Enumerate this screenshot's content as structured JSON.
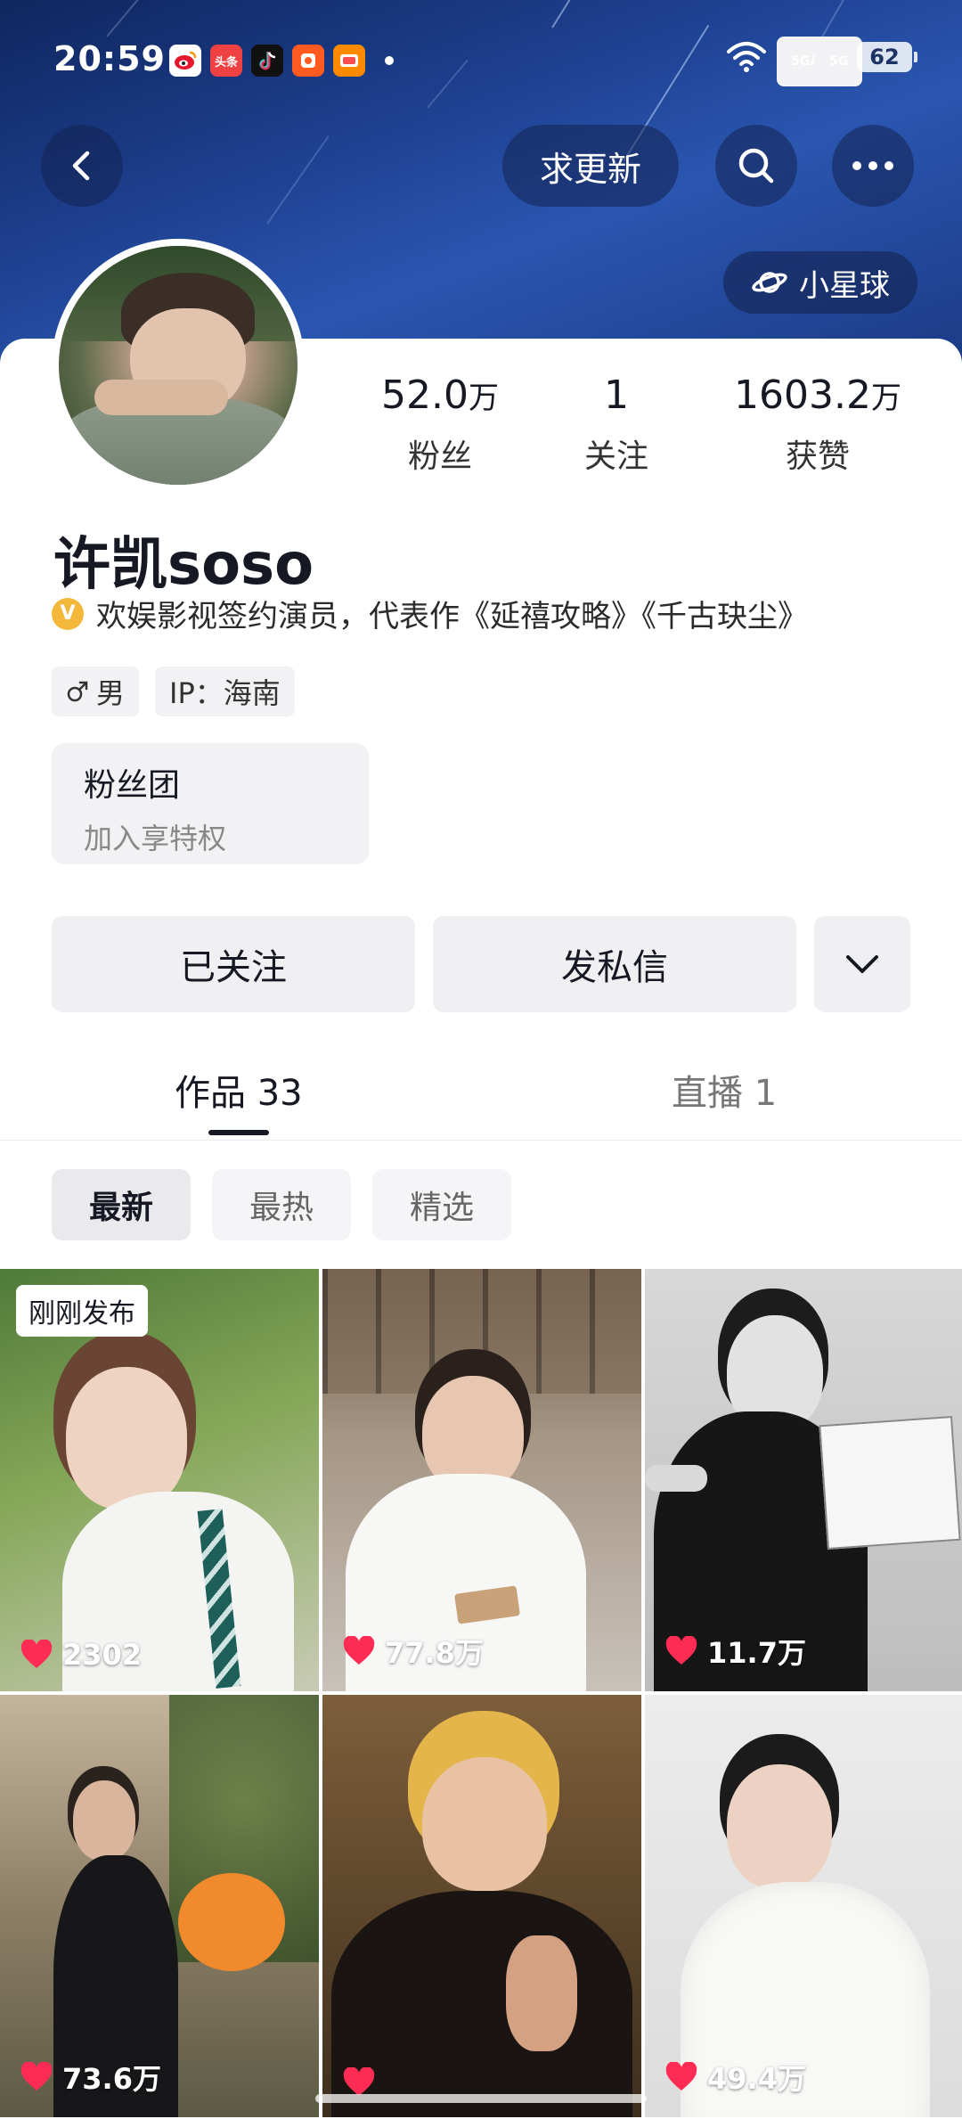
{
  "status_bar": {
    "time": "20:59",
    "notification_icons": [
      {
        "name": "weibo-app-icon",
        "label": "",
        "color": "#e6162d"
      },
      {
        "name": "toutiao-app-icon",
        "label": "头条",
        "color": "#f04142"
      },
      {
        "name": "douyin-app-icon",
        "label": "",
        "color": "#111111"
      },
      {
        "name": "app-icon",
        "label": "",
        "color": "#ff5a1f"
      },
      {
        "name": "app-icon-2",
        "label": "",
        "color": "#ff8a00"
      }
    ],
    "signal1": "5GA",
    "signal2": "5G",
    "battery": "62"
  },
  "nav": {
    "request_update": "求更新",
    "planet": "小星球"
  },
  "profile": {
    "stats": [
      {
        "value": "52.0",
        "unit": "万",
        "label": "粉丝"
      },
      {
        "value": "1",
        "unit": "",
        "label": "关注"
      },
      {
        "value": "1603.2",
        "unit": "万",
        "label": "获赞"
      }
    ],
    "name": "许凯soso",
    "verify_badge": "V",
    "verified_text": "欢娱影视签约演员，代表作《延禧攻略》《千古玦尘》",
    "gender": "男",
    "ip": "IP：海南",
    "fan_club_title": "粉丝团",
    "fan_club_subtitle": "加入享特权"
  },
  "actions": {
    "following": "已关注",
    "message": "发私信"
  },
  "tabs": [
    {
      "label": "作品 33",
      "active": true
    },
    {
      "label": "直播 1",
      "active": false
    }
  ],
  "filters": [
    {
      "label": "最新",
      "active": true
    },
    {
      "label": "最热",
      "active": false
    },
    {
      "label": "精选",
      "active": false
    }
  ],
  "videos": [
    {
      "likes": "2302",
      "badge": "刚刚发布"
    },
    {
      "likes": "77.8万",
      "badge": ""
    },
    {
      "likes": "11.7万",
      "badge": ""
    },
    {
      "likes": "73.6万",
      "badge": ""
    },
    {
      "likes": "",
      "badge": ""
    },
    {
      "likes": "49.4万",
      "badge": ""
    }
  ],
  "colors": {
    "header_bg": "#1d3f8e",
    "like_heart": "#fe2c55",
    "verify_badge": "#f3b73a"
  }
}
